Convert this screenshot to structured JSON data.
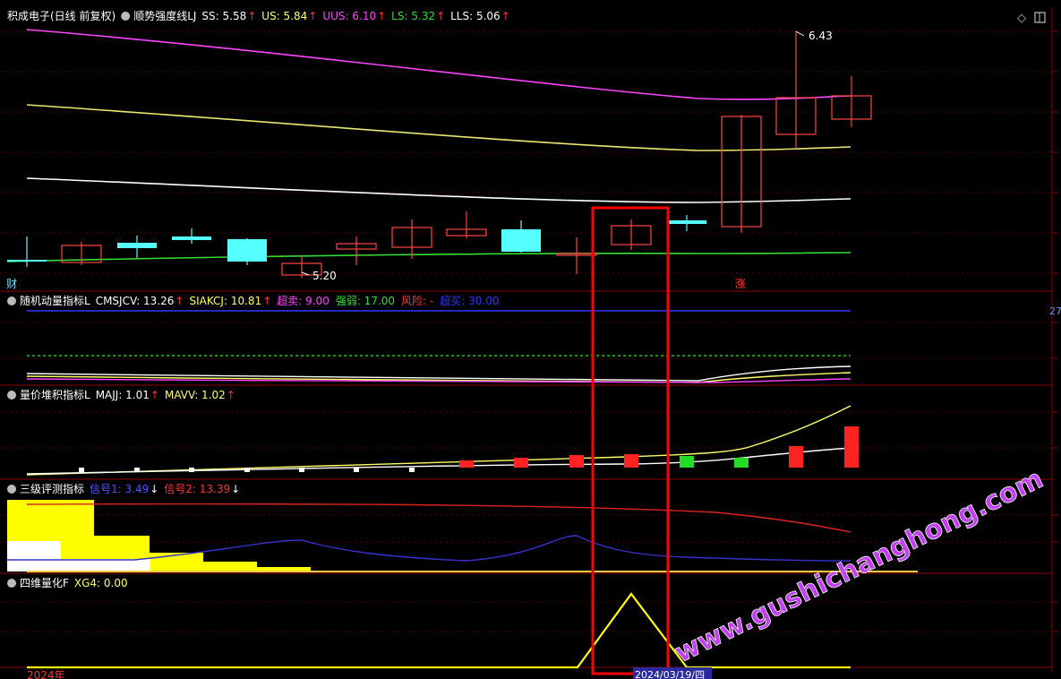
{
  "stock": {
    "name": "积成电子",
    "period": "(日线 前复权)",
    "indicator": "顺势强度线LJ"
  },
  "panel1": {
    "items": [
      {
        "label": "SS: 5.58",
        "color": "#ffffff"
      },
      {
        "label": "US: 5.84",
        "color": "#ffff66"
      },
      {
        "label": "UUS: 6.10",
        "color": "#ff44ff"
      },
      {
        "label": "LS: 5.32",
        "color": "#33dd33"
      },
      {
        "label": "LLS: 5.06",
        "color": "#ffffff"
      }
    ],
    "high_label": "6.43",
    "low_label": "5.20",
    "marker_left": "财",
    "marker_right": "涨"
  },
  "panel2": {
    "name": "随机动量指标L",
    "items": [
      {
        "label": "CMSJCV: 13.26",
        "color": "#ffffff"
      },
      {
        "label": "SIAKCJ: 10.81",
        "color": "#ffff66"
      },
      {
        "label": "超卖: 9.00",
        "color": "#ff44ff"
      },
      {
        "label": "强弱: 17.00",
        "color": "#33dd33"
      },
      {
        "label": "风险: -",
        "color": "#ff3333"
      },
      {
        "label": "超买: 30.00",
        "color": "#3333ff"
      }
    ],
    "right_value": "27"
  },
  "panel3": {
    "name": "量价堆积指标L",
    "items": [
      {
        "label": "MAJJ: 1.01",
        "color": "#ffffff"
      },
      {
        "label": "MAVV: 1.02",
        "color": "#ffff66"
      }
    ]
  },
  "panel4": {
    "name": "三级评测指标",
    "items": [
      {
        "label": "信号1: 3.49",
        "color": "#5555ff",
        "arrow": "down"
      },
      {
        "label": "信号2: 13.39",
        "color": "#ff3333",
        "arrow": "down"
      }
    ]
  },
  "panel5": {
    "name": "四维量化F",
    "items": [
      {
        "label": "XG4: 0.00",
        "color": "#ffff66"
      }
    ]
  },
  "axis": {
    "year_label": "2024年",
    "cursor_date": "2024/03/19/四"
  },
  "watermark": "www.gushichanghong.com",
  "colors": {
    "up": "#ff4444",
    "down": "#55ffff",
    "highlight": "#ff0000",
    "panel_border": "#8b0000"
  }
}
